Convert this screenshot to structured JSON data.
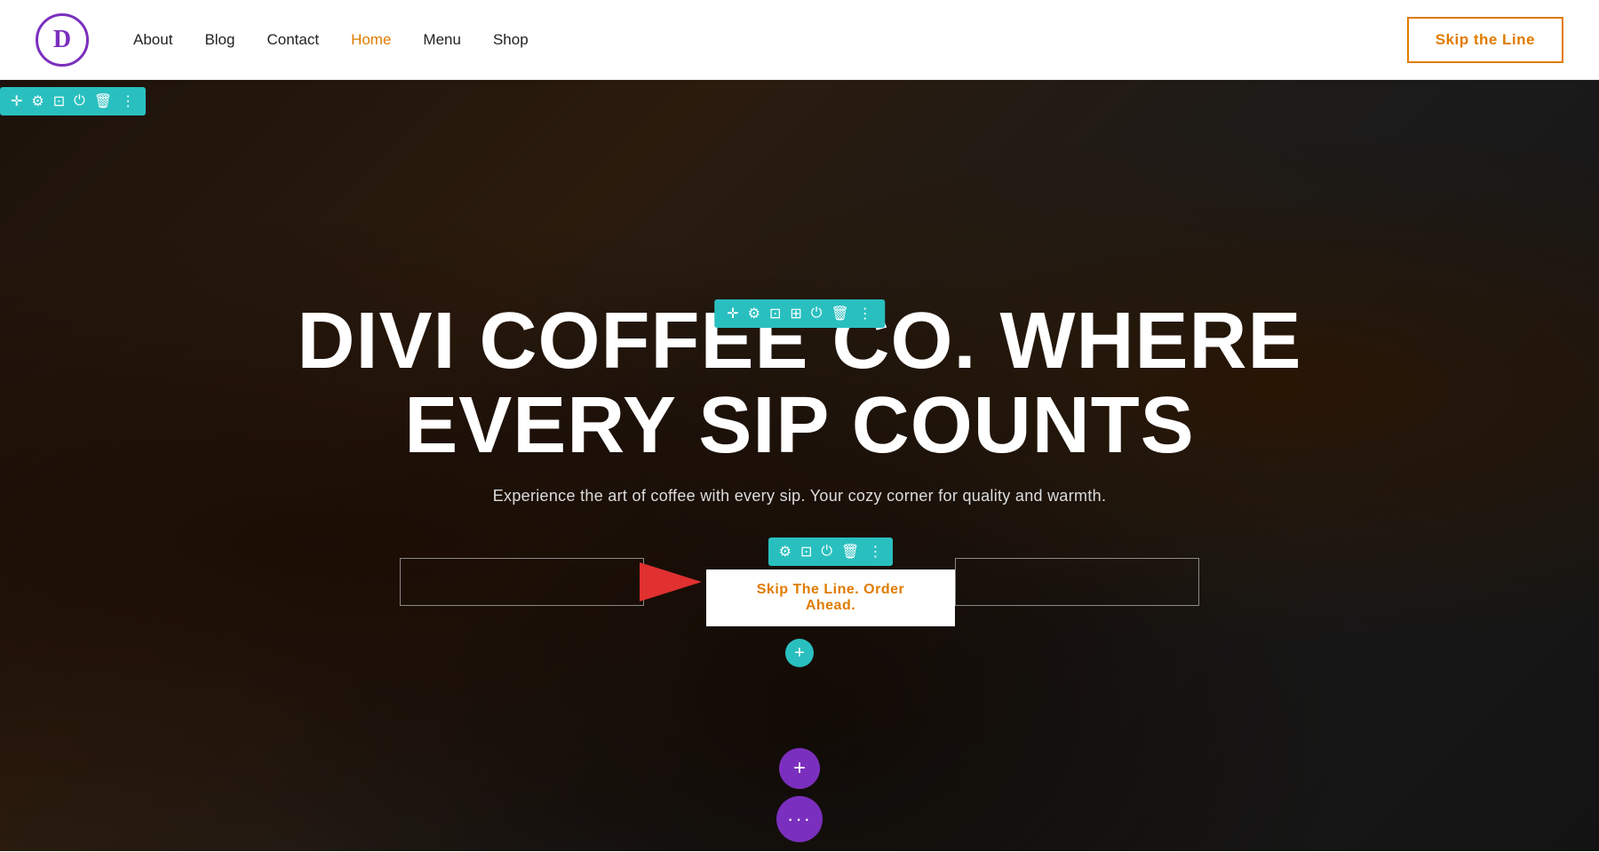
{
  "navbar": {
    "logo_letter": "D",
    "nav_items": [
      {
        "label": "About",
        "active": false
      },
      {
        "label": "Blog",
        "active": false
      },
      {
        "label": "Contact",
        "active": false
      },
      {
        "label": "Home",
        "active": true
      },
      {
        "label": "Menu",
        "active": false
      },
      {
        "label": "Shop",
        "active": false
      }
    ],
    "cta_label": "Skip the Line"
  },
  "hero": {
    "title_line1": "DIVI COFFEE CO. WHERE",
    "title_line2": "EVERY SIP COUNTS",
    "subtitle": "Experience the art of coffee with every sip. Your cozy corner for quality and warmth.",
    "cta_button_label": "Skip The Line. Order Ahead.",
    "top_toolbar_icons": [
      "+",
      "⚙",
      "⊡",
      "⏻",
      "🗑",
      "⋮"
    ],
    "mid_toolbar_icons": [
      "+",
      "⚙",
      "⊡",
      "⊞",
      "⏻",
      "🗑",
      "⋮"
    ],
    "btn_toolbar_icons": [
      "⚙",
      "⊡",
      "⏻",
      "🗑",
      "⋮"
    ],
    "plus_small_label": "+",
    "plus_large_label": "+",
    "dots_label": "···"
  },
  "colors": {
    "teal": "#2ABFBF",
    "purple": "#7b2fbe",
    "orange": "#e07b00",
    "red_arrow": "#e03030",
    "white": "#ffffff"
  }
}
